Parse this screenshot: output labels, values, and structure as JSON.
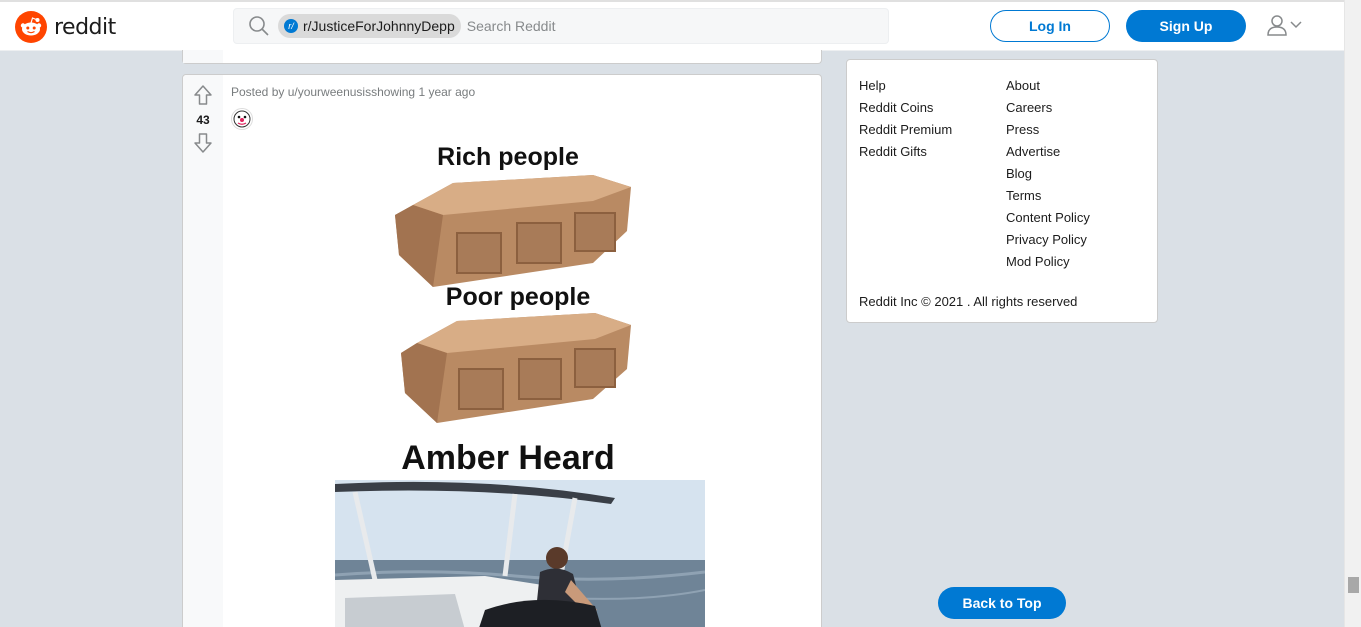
{
  "header": {
    "logo_text": "reddit",
    "search": {
      "community_chip": "r/JusticeForJohnnyDepp",
      "chip_icon_letter": "r/",
      "placeholder": "Search Reddit"
    },
    "login_label": "Log In",
    "signup_label": "Sign Up"
  },
  "post": {
    "score": "43",
    "meta": "Posted by u/yourweenusisshowing 1 year ago",
    "image": {
      "caption_1": "Rich people",
      "caption_2": "Poor people",
      "caption_3": "Amber Heard"
    }
  },
  "sidebar": {
    "links_left": [
      "Help",
      "Reddit Coins",
      "Reddit Premium",
      "Reddit Gifts"
    ],
    "links_right": [
      "About",
      "Careers",
      "Press",
      "Advertise",
      "Blog",
      "Terms",
      "Content Policy",
      "Privacy Policy",
      "Mod Policy"
    ],
    "copyright": "Reddit Inc © 2021 . All rights reserved"
  },
  "back_to_top_label": "Back to Top",
  "colors": {
    "brand": "#ff4500",
    "accent": "#0079d3",
    "background": "#dae0e6"
  }
}
